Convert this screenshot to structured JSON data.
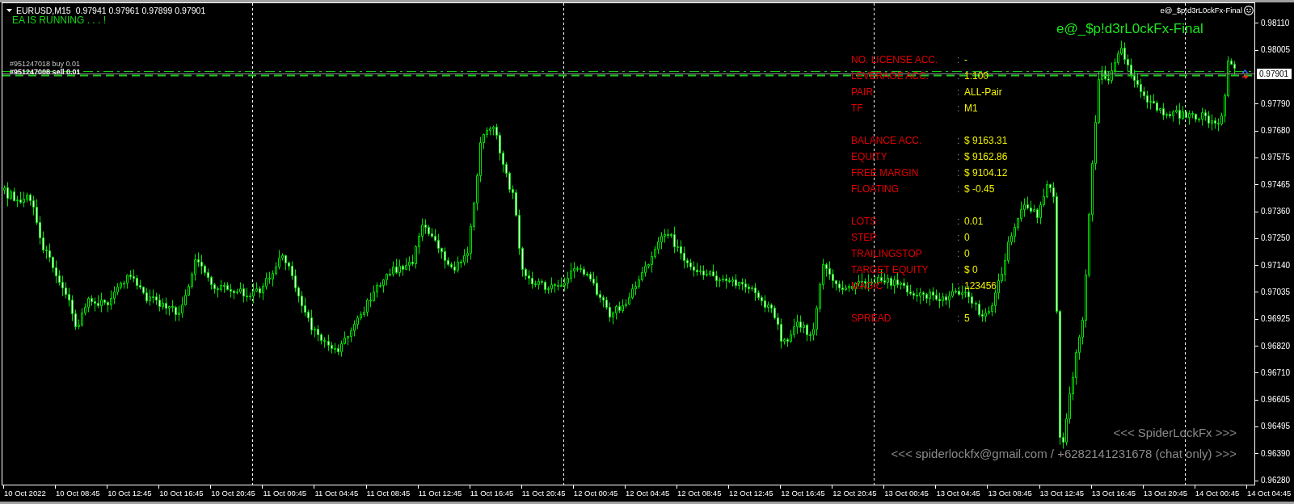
{
  "chart_header": {
    "symbol": "EURUSD,M15",
    "quotes": "0.97941 0.97961 0.97899 0.97901",
    "status": "EA IS RUNNING . . . !"
  },
  "order_labels": [
    {
      "kind": "buy",
      "text": "#951247018 buy 0.01"
    },
    {
      "kind": "sell",
      "text": "#951247008 sell 0.01"
    }
  ],
  "expert": {
    "caption": "e@_$p!d3rL0ckFx-Final",
    "title": "e@_$p!d3rL0ckFx-Final"
  },
  "info_panel": {
    "groups": [
      {
        "rows": [
          {
            "label": "NO. LICENSE ACC.",
            "colon": ":",
            "value": "-"
          },
          {
            "label": "LEVERAGE ACC.",
            "colon": ":",
            "value": "1:100"
          },
          {
            "label": "PAIR",
            "colon": ":",
            "value": "ALL-Pair"
          },
          {
            "label": "TF",
            "colon": ":",
            "value": "M1"
          }
        ]
      },
      {
        "rows": [
          {
            "label": "BALANCE ACC.",
            "colon": ":",
            "value": "$ 9163.31"
          },
          {
            "label": "EQUITY",
            "colon": ":",
            "value": "$ 9162.86"
          },
          {
            "label": "FREE MARGIN",
            "colon": ":",
            "value": "$ 9104.12"
          },
          {
            "label": "FLOATING",
            "colon": ":",
            "value": "$ -0.45"
          }
        ]
      },
      {
        "rows": [
          {
            "label": "LOTS",
            "colon": ":",
            "value": "0.01"
          },
          {
            "label": "STEP",
            "colon": ":",
            "value": "0"
          },
          {
            "label": "TRAILINGSTOP",
            "colon": ":",
            "value": "0"
          },
          {
            "label": "TARGET EQUITY",
            "colon": ":",
            "value": "$ 0"
          },
          {
            "label": "MAGIC",
            "colon": ":",
            "value": "123456"
          }
        ]
      },
      {
        "rows": [
          {
            "label": "SPREAD",
            "colon": ":",
            "value": "5"
          }
        ]
      }
    ]
  },
  "footer": {
    "lines": [
      "<<< SpiderLockFx >>>",
      "<<< spiderlockfx@gmail.com / +6282141231678 (chat only) >>>"
    ]
  },
  "price_axis": {
    "labels": [
      "0.98110",
      "0.98005",
      "0.97790",
      "0.97680",
      "0.97575",
      "0.97465",
      "0.97360",
      "0.97250",
      "0.97140",
      "0.97035",
      "0.96925",
      "0.96820",
      "0.96710",
      "0.96605",
      "0.96495",
      "0.96390",
      "0.96280"
    ],
    "current_price": "0.97901"
  },
  "time_axis": {
    "labels": [
      "10 Oct 2022",
      "10 Oct 08:45",
      "10 Oct 12:45",
      "10 Oct 16:45",
      "10 Oct 20:45",
      "11 Oct 00:45",
      "11 Oct 04:45",
      "11 Oct 08:45",
      "11 Oct 12:45",
      "11 Oct 16:45",
      "11 Oct 20:45",
      "12 Oct 00:45",
      "12 Oct 04:45",
      "12 Oct 08:45",
      "12 Oct 12:45",
      "12 Oct 16:45",
      "12 Oct 20:45",
      "13 Oct 00:45",
      "13 Oct 04:45",
      "13 Oct 08:45",
      "13 Oct 12:45",
      "13 Oct 16:45",
      "13 Oct 20:45",
      "14 Oct 00:45",
      "14 Oct 04:45"
    ]
  }
}
